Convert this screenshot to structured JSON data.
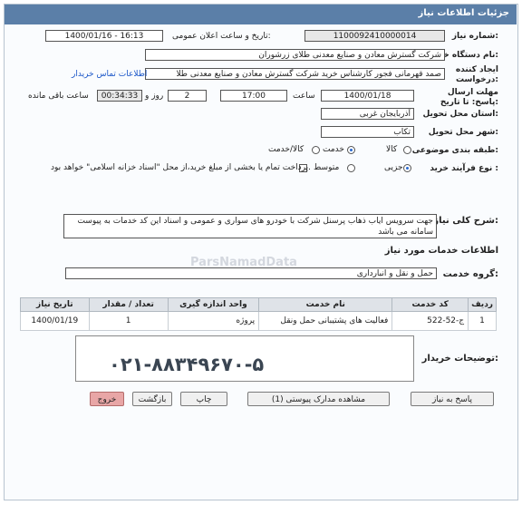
{
  "header": {
    "title": "جزئیات اطلاعات نیاز"
  },
  "fields": {
    "need_number_label": "شماره نیاز:",
    "need_number": "1100092410000014",
    "announce_label": "تاریخ و ساعت اعلان عمومی:",
    "announce_value": "1400/01/16 - 16:13",
    "buyer_org_label": "نام دستگاه خریدار:",
    "buyer_org": "شرکت گسترش معادن و صنایع معدنی طلای زرشوران",
    "creator_label": "ایجاد کننده درخواست:",
    "creator": "صمد قهرمانی فجور کارشناس خرید شرکت گسترش معادن و صنایع معدنی طلا",
    "contact_link": "اطلاعات تماس خریدار",
    "deadline_label": "مهلت ارسال پاسخ: تا تاریخ:",
    "deadline_date": "1400/01/18",
    "hour_label": "ساعت",
    "deadline_time": "17:00",
    "days_value": "2",
    "days_label": "روز و",
    "remaining_time": "00:34:33",
    "remaining_label": "ساعت باقی مانده",
    "province_label": "استان محل تحویل:",
    "province": "آذربایجان غربی",
    "city_label": "شهر محل تحویل:",
    "city": "تکاب",
    "category_label": "طبقه بندی موضوعی:",
    "category_options": [
      "کالا",
      "خدمت",
      "کالا/خدمت"
    ],
    "category_selected": "خدمت",
    "purchase_label": "نوع فرآیند خرید :",
    "purchase_options": [
      "جزیی",
      "متوسط"
    ],
    "purchase_selected": "جزیی",
    "payment_note": "پرداخت تمام یا بخشی از مبلغ خرید،از محل \"اسناد خزانه اسلامی\" خواهد بود."
  },
  "description": {
    "label": "شرح کلی نیاز:",
    "text": "جهت سرویس ایاب ذهاب پرسنل شرکت با خودرو های سواری و عمومی و اسناد این کد خدمات به پیوست سامانه می باشد"
  },
  "services": {
    "section_title": "اطلاعات خدمات مورد نیاز",
    "group_label": "گروه خدمت:",
    "group_value": "حمل و نقل و انبارداری",
    "columns": [
      "ردیف",
      "کد خدمت",
      "نام خدمت",
      "واحد اندازه گیری",
      "تعداد / مقدار",
      "تاریخ نیاز"
    ],
    "rows": [
      [
        "1",
        "ج-52-522",
        "فعالیت های پشتیبانی حمل ونقل",
        "پروژه",
        "1",
        "1400/01/19"
      ]
    ]
  },
  "notes": {
    "label": "توضیحات خریدار:",
    "phone": "۰۲۱-۸۸۳۴۹۶۷۰-۵"
  },
  "watermark": {
    "text": "ParsNamadData"
  },
  "buttons": {
    "reply": "پاسخ به نیاز",
    "attachments": "مشاهده مدارک پیوستی (1)",
    "print": "چاپ",
    "back": "بازگشت",
    "exit": "خروج"
  }
}
